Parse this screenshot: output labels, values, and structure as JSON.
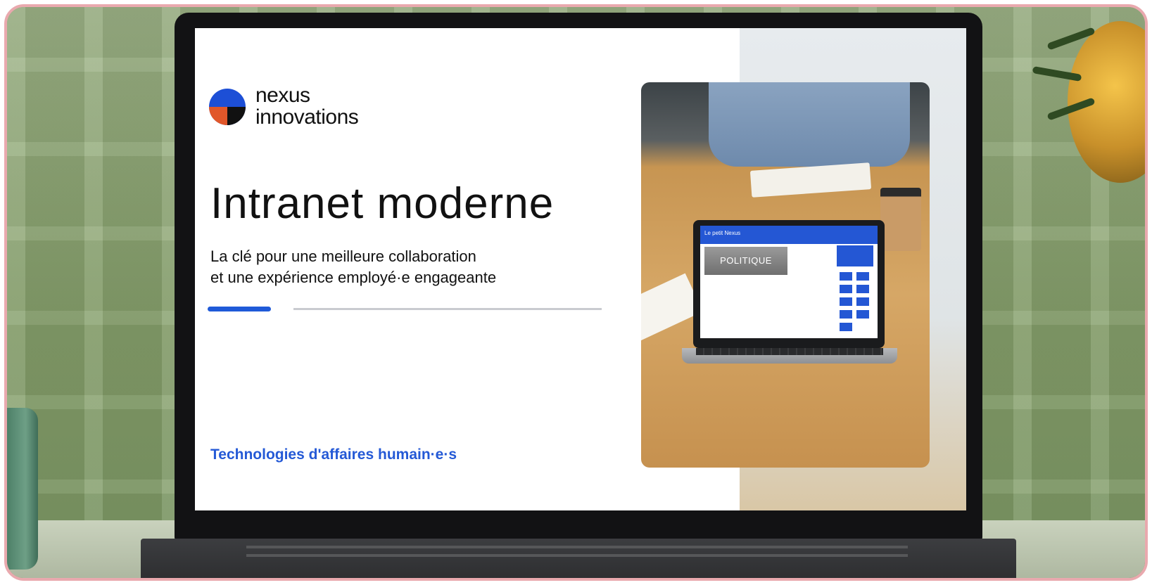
{
  "brand": {
    "line1": "nexus",
    "line2": "innovations"
  },
  "hero": {
    "title": "Intranet moderne",
    "subtitle_line1": "La clé pour une meilleure collaboration",
    "subtitle_line2": "et une expérience employé·e engageante"
  },
  "tagline": "Technologies d'affaires humain·e·s",
  "inner_screen": {
    "header_text": "Le petit Nexus",
    "hero_text": "POLITIQUE"
  },
  "colors": {
    "accent_blue": "#1f5ad8",
    "logo_orange": "#e1572a",
    "frame_pink": "#e9a9ae"
  }
}
